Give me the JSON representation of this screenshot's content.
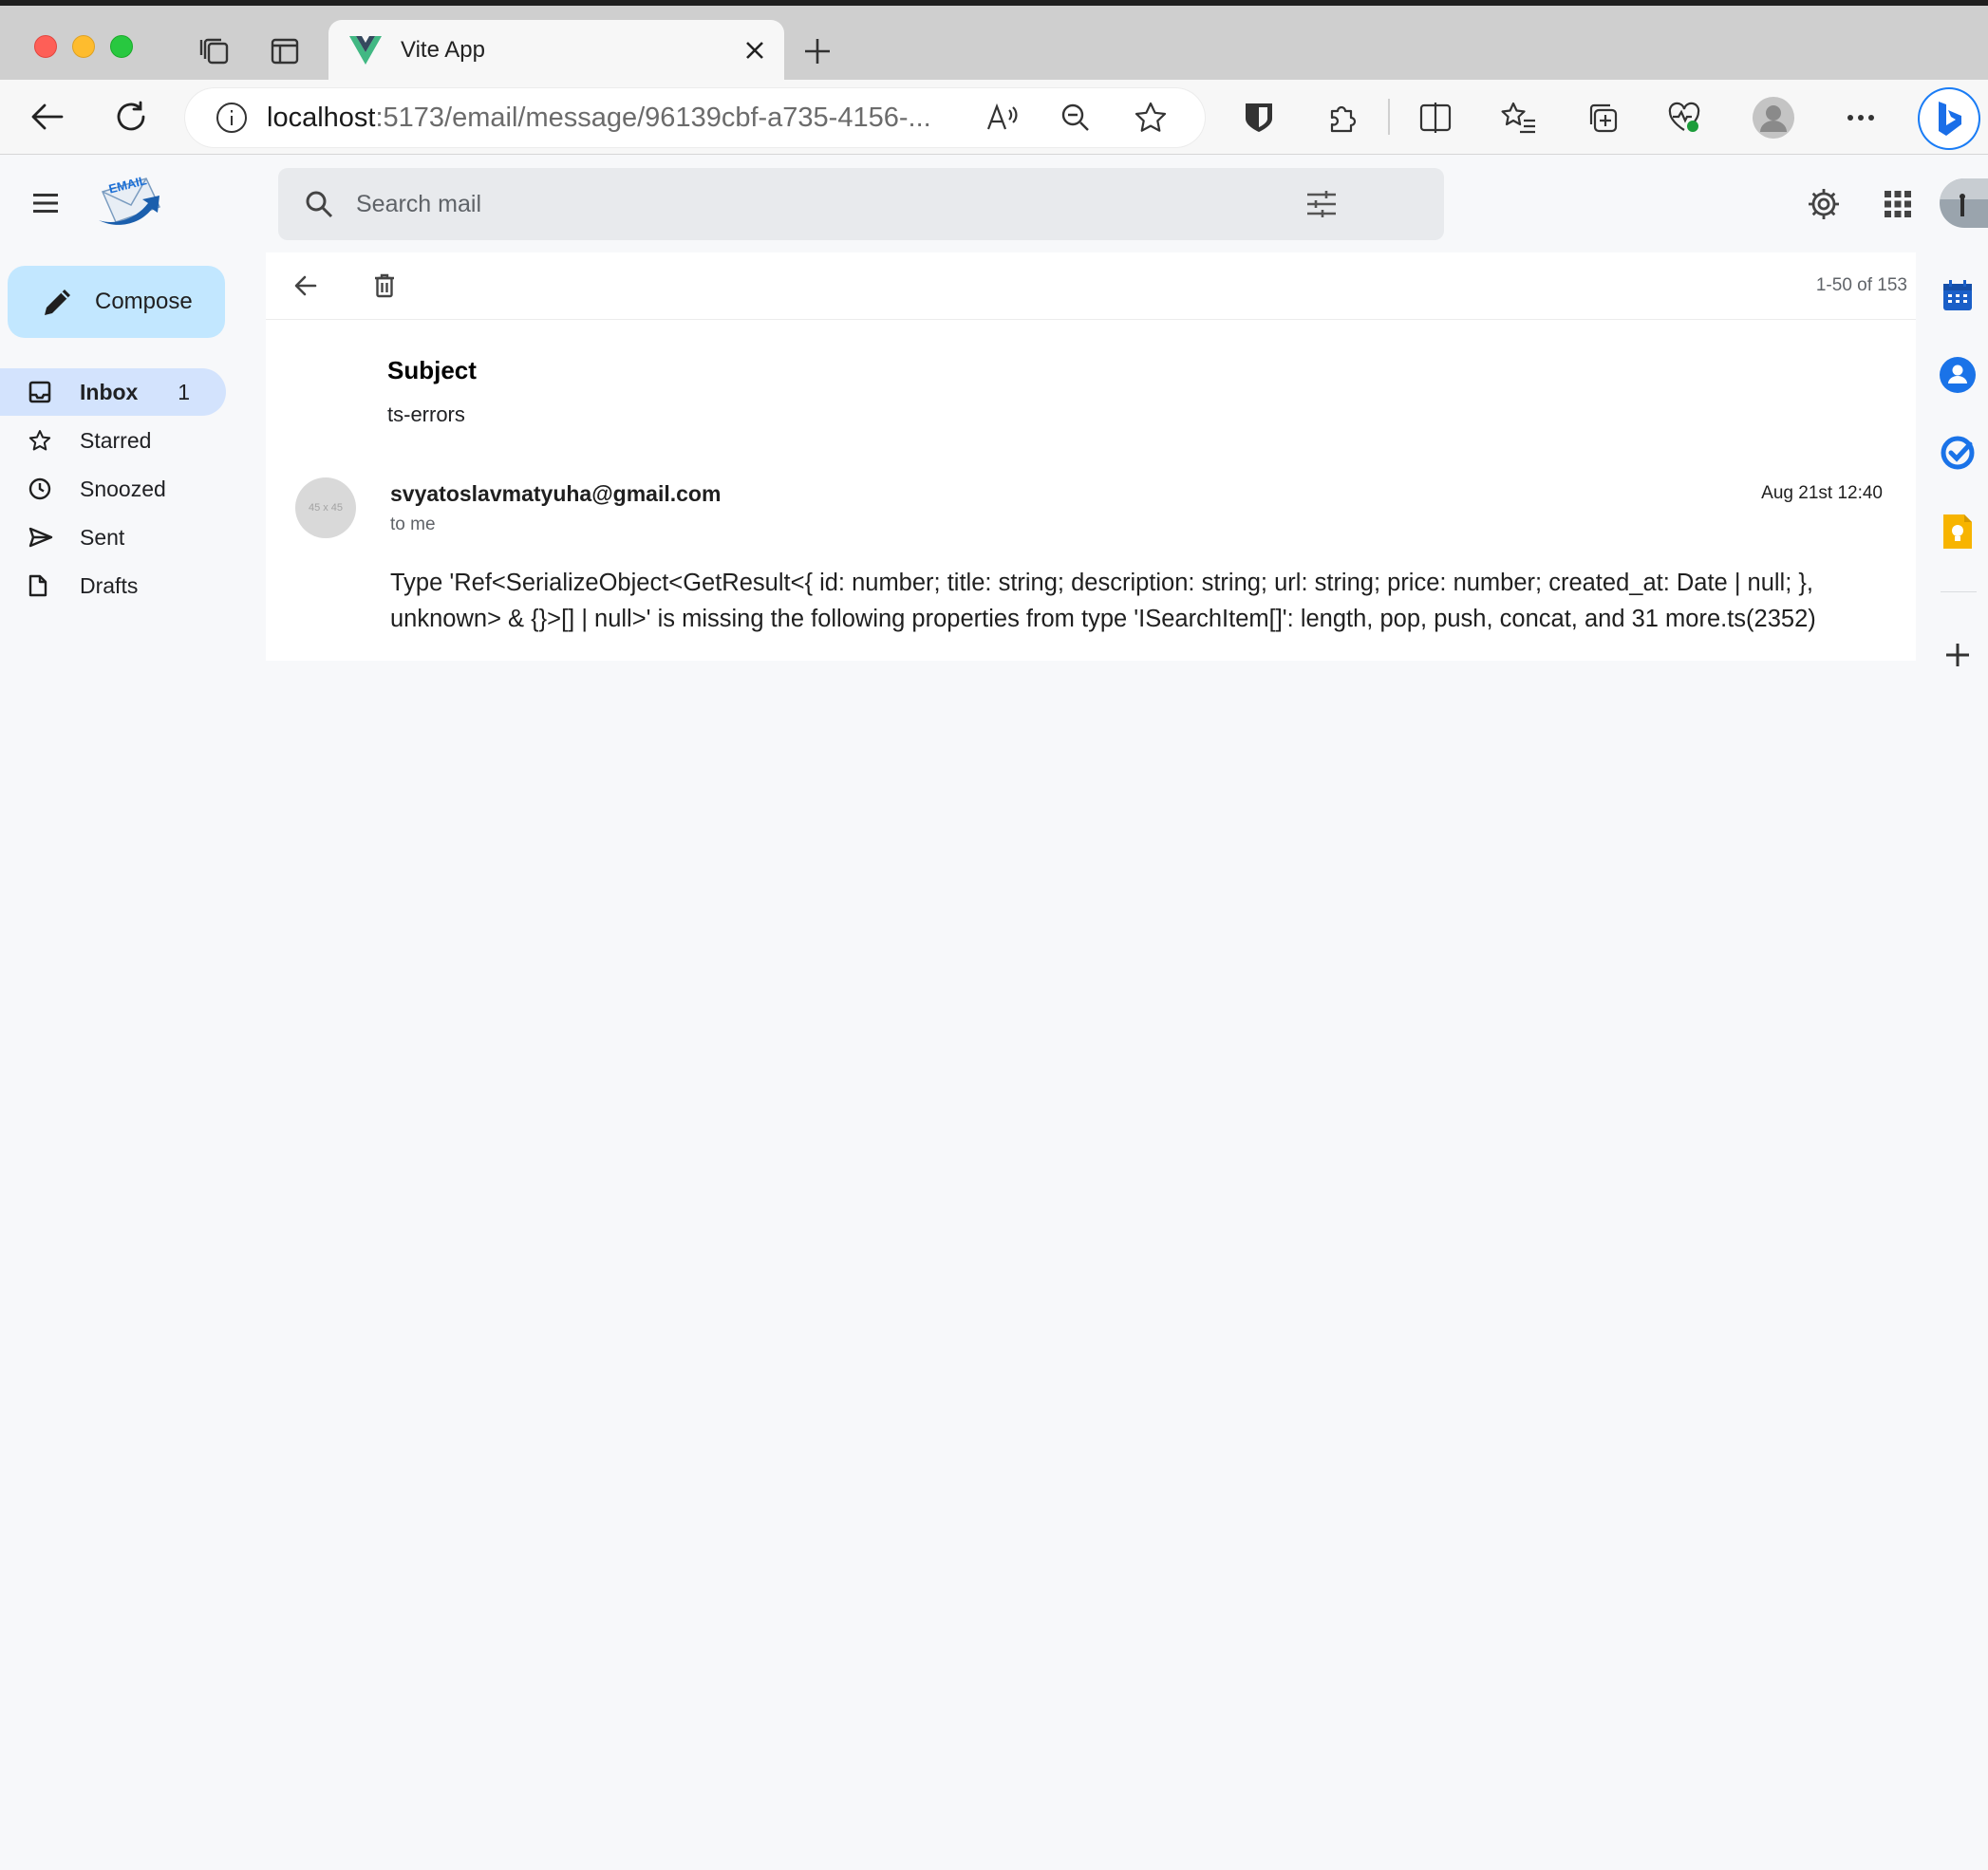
{
  "browser": {
    "tab_title": "Vite App",
    "url_host": "localhost",
    "url_rest": ":5173/email/message/96139cbf-a735-4156-..."
  },
  "app": {
    "search_placeholder": "Search mail",
    "logo_text": "EMAIL"
  },
  "nav": {
    "compose_label": "Compose",
    "items": [
      {
        "label": "Inbox",
        "count": "1",
        "icon": "inbox-icon"
      },
      {
        "label": "Starred",
        "icon": "star-icon"
      },
      {
        "label": "Snoozed",
        "icon": "clock-icon"
      },
      {
        "label": "Sent",
        "icon": "send-icon"
      },
      {
        "label": "Drafts",
        "icon": "draft-icon"
      }
    ]
  },
  "message": {
    "pagination": "1-50 of 153",
    "subject_heading": "Subject",
    "subject": "ts-errors",
    "avatar_placeholder": "45 x 45",
    "sender": "svyatoslavmatyuha@gmail.com",
    "recipient": "to me",
    "date": "Aug 21st 12:40",
    "body": "Type 'Ref<SerializeObject<GetResult<{ id: number; title: string; description: string; url: string; price: number; created_at: Date | null; }, unknown> & {}>[] | null>' is missing the following properties from type 'ISearchItem[]': length, pop, push, concat, and 31 more.ts(2352)"
  },
  "colors": {
    "compose_bg": "#c2e7ff",
    "inbox_active_bg": "#d3e3fd",
    "page_bg": "#f7f8fa"
  }
}
